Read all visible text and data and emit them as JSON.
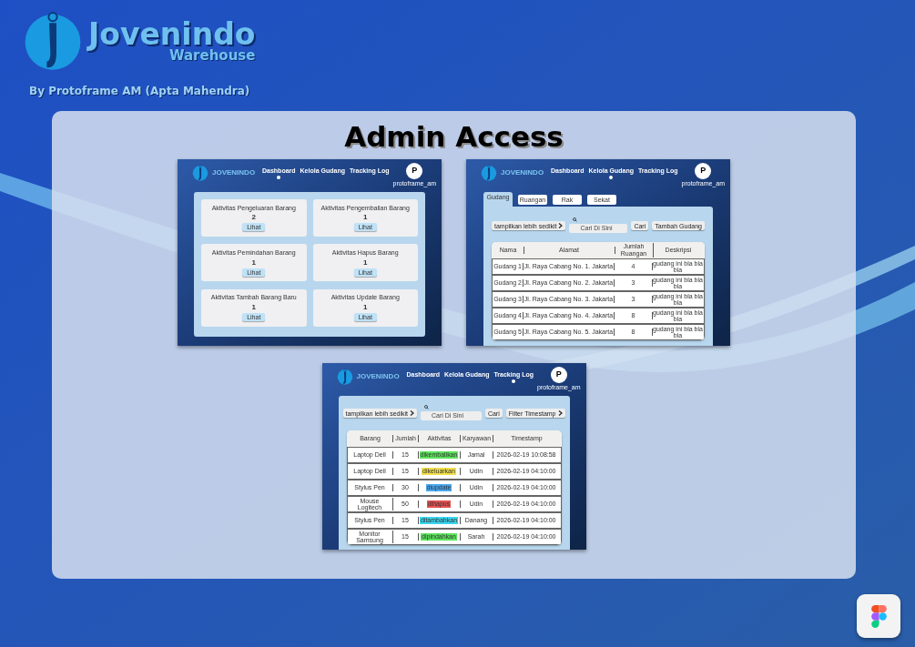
{
  "brand": {
    "title": "Jovenindo",
    "subtitle": "Warehouse",
    "credit": "By Protoframe AM (Apta Mahendra)"
  },
  "heading": "Admin Access",
  "screens": [
    {
      "kind": "dashboard",
      "brand": "JOVENINDO",
      "nav": [
        {
          "label": "Dashboard",
          "selected": true
        },
        {
          "label": "Kelola Gudang",
          "selected": false
        },
        {
          "label": "Tracking Log",
          "selected": false
        }
      ],
      "avatar": {
        "initial": "P",
        "username": "protoframe_am"
      },
      "cards": [
        {
          "title": "Aktivitas Pengeluaran Barang",
          "count": "2",
          "button": "Lihat"
        },
        {
          "title": "Aktivitas Pengembalian Barang",
          "count": "1",
          "button": "Lihat"
        },
        {
          "title": "Aktivitas Pemindahan Barang",
          "count": "1",
          "button": "Lihat"
        },
        {
          "title": "Aktivitas Hapus Barang",
          "count": "1",
          "button": "Lihat"
        },
        {
          "title": "Aktivitas Tambah Barang Baru",
          "count": "1",
          "button": "Lihat"
        },
        {
          "title": "Aktivitas Update Barang",
          "count": "1",
          "button": "Lihat"
        }
      ]
    },
    {
      "kind": "gudang",
      "brand": "JOVENINDO",
      "nav": [
        {
          "label": "Dashboard",
          "selected": false
        },
        {
          "label": "Kelola Gudang",
          "selected": true
        },
        {
          "label": "Tracking Log",
          "selected": false
        }
      ],
      "avatar": {
        "initial": "P",
        "username": "protoframe_am"
      },
      "tabs": [
        {
          "label": "Gudang",
          "selected": true
        },
        {
          "label": "Ruangan",
          "selected": false
        },
        {
          "label": "Rak",
          "selected": false
        },
        {
          "label": "Sekat",
          "selected": false
        }
      ],
      "toolbar": {
        "toggle": "tampilkan lebih sedikit",
        "placeholder": "Cari Di Sini",
        "search_button": "Cari",
        "action_button": "Tambah Gudang"
      },
      "table": {
        "columns": [
          "Nama",
          "Alamat",
          "Jumlah Ruangan",
          "Deskripsi"
        ],
        "rows": [
          [
            "Gudang 1",
            "Jl. Raya Cabang No. 1. Jakarta",
            "4",
            "gudang ini bla bla bla"
          ],
          [
            "Gudang 2",
            "Jl. Raya Cabang No. 2. Jakarta",
            "3",
            "gudang ini bla bla bla"
          ],
          [
            "Gudang 3",
            "Jl. Raya Cabang No. 3. Jakarta",
            "3",
            "gudang ini bla bla bla"
          ],
          [
            "Gudang 4",
            "Jl. Raya Cabang No. 4. Jakarta",
            "8",
            "gudang ini bla bla bla"
          ],
          [
            "Gudang 5",
            "Jl. Raya Cabang No. 5. Jakarta",
            "8",
            "gudang ini bla bla bla"
          ]
        ]
      }
    },
    {
      "kind": "tracking",
      "brand": "JOVENINDO",
      "nav": [
        {
          "label": "Dashboard",
          "selected": false
        },
        {
          "label": "Kelola Gudang",
          "selected": false
        },
        {
          "label": "Tracking Log",
          "selected": true
        }
      ],
      "avatar": {
        "initial": "P",
        "username": "protoframe_am"
      },
      "toolbar": {
        "toggle": "tampilkan lebih sedikit",
        "placeholder": "Cari Di Sini",
        "search_button": "Cari",
        "action_button": "Filter Timestamp"
      },
      "table": {
        "columns": [
          "Barang",
          "Jumlah",
          "Aktivitas",
          "Karyawan",
          "Timestamp"
        ],
        "rows": [
          {
            "barang": "Laptop Dell",
            "jumlah": "15",
            "aktivitas": "dikembalikan",
            "color": "#5be35b",
            "karyawan": "Jamal",
            "timestamp": "2026-02-19 10:08:58"
          },
          {
            "barang": "Laptop Dell",
            "jumlah": "15",
            "aktivitas": "dikeluarkan",
            "color": "#f2e04c",
            "karyawan": "Udin",
            "timestamp": "2026-02-19 04:10:00"
          },
          {
            "barang": "Stylus Pen",
            "jumlah": "30",
            "aktivitas": "diupdate",
            "color": "#4aa8f0",
            "karyawan": "Udin",
            "timestamp": "2026-02-19 04:10:00"
          },
          {
            "barang": "Mouse Logitech",
            "jumlah": "50",
            "aktivitas": "dihapus",
            "color": "#e45050",
            "karyawan": "Udin",
            "timestamp": "2026-02-19 04:10:00"
          },
          {
            "barang": "Stylus Pen",
            "jumlah": "15",
            "aktivitas": "ditambahkan",
            "color": "#3ad6ef",
            "karyawan": "Danang",
            "timestamp": "2026-02-19 04:10:00"
          },
          {
            "barang": "Monitor Samsung",
            "jumlah": "15",
            "aktivitas": "dipindahkan",
            "color": "#5be35b",
            "karyawan": "Sarah",
            "timestamp": "2026-02-19 04:10:00"
          }
        ]
      }
    }
  ]
}
